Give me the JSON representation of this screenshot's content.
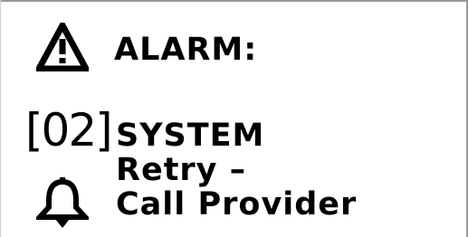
{
  "alarm": {
    "title": "ALARM:",
    "code": "[02]",
    "source": "SYSTEM",
    "message_line_1": "Retry –",
    "message_line_2": "Call Provider"
  },
  "icons": {
    "status_icon": "warning-triangle-icon",
    "notification_icon": "bell-icon"
  },
  "colors": {
    "background": "#ffffff",
    "foreground": "#000000",
    "frame": "#9a9a9a"
  }
}
